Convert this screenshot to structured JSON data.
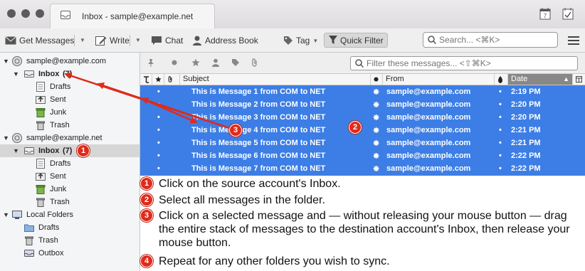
{
  "window": {
    "tab_title": "Inbox - sample@example.net"
  },
  "toolbar": {
    "get_messages": "Get Messages",
    "write": "Write",
    "chat": "Chat",
    "address_book": "Address Book",
    "tag": "Tag",
    "quick_filter": "Quick Filter",
    "search_placeholder": "Search... <⌘K>"
  },
  "folders": {
    "account1": {
      "name": "sample@example.com",
      "inbox": "Inbox",
      "inbox_count": "(7)",
      "items": [
        "Drafts",
        "Sent",
        "Junk",
        "Trash"
      ]
    },
    "account2": {
      "name": "sample@example.net",
      "inbox": "Inbox",
      "inbox_count": "(7)",
      "items": [
        "Drafts",
        "Sent",
        "Junk",
        "Trash"
      ]
    },
    "local": {
      "name": "Local Folders",
      "items": [
        "Drafts",
        "Trash",
        "Outbox"
      ]
    }
  },
  "filterbar": {
    "filter_placeholder": "Filter these messages... <⇧⌘K>"
  },
  "columns": {
    "subject": "Subject",
    "from": "From",
    "date": "Date"
  },
  "messages": [
    {
      "subject": "This is Message 1 from COM to NET",
      "from": "sample@example.com",
      "date": "2:19 PM"
    },
    {
      "subject": "This is Message 2 from COM to NET",
      "from": "sample@example.com",
      "date": "2:20 PM"
    },
    {
      "subject": "This is Message 3 from COM to NET",
      "from": "sample@example.com",
      "date": "2:20 PM"
    },
    {
      "subject": "This is Message 4 from COM to NET",
      "from": "sample@example.com",
      "date": "2:21 PM"
    },
    {
      "subject": "This is Message 5 from COM to NET",
      "from": "sample@example.com",
      "date": "2:21 PM"
    },
    {
      "subject": "This is Message 6 from COM to NET",
      "from": "sample@example.com",
      "date": "2:22 PM"
    },
    {
      "subject": "This is Message 7 from COM to NET",
      "from": "sample@example.com",
      "date": "2:22 PM"
    }
  ],
  "annotations": {
    "badge1": "1",
    "badge2": "2",
    "badge3": "3",
    "badge4": "4"
  },
  "steps": [
    {
      "num": "1",
      "text": "Click on the source account's Inbox."
    },
    {
      "num": "2",
      "text": "Select all messages in the folder."
    },
    {
      "num": "3",
      "text": "Click on a selected message and — without releasing your mouse button — drag the entire stack of messages to the destination account's Inbox, then release your mouse button."
    },
    {
      "num": "4",
      "text": "Repeat for any other folders you wish to sync."
    }
  ],
  "colors": {
    "selection": "#3c7ee5",
    "badge": "#e02a1a",
    "arrow": "#e02a1a"
  }
}
